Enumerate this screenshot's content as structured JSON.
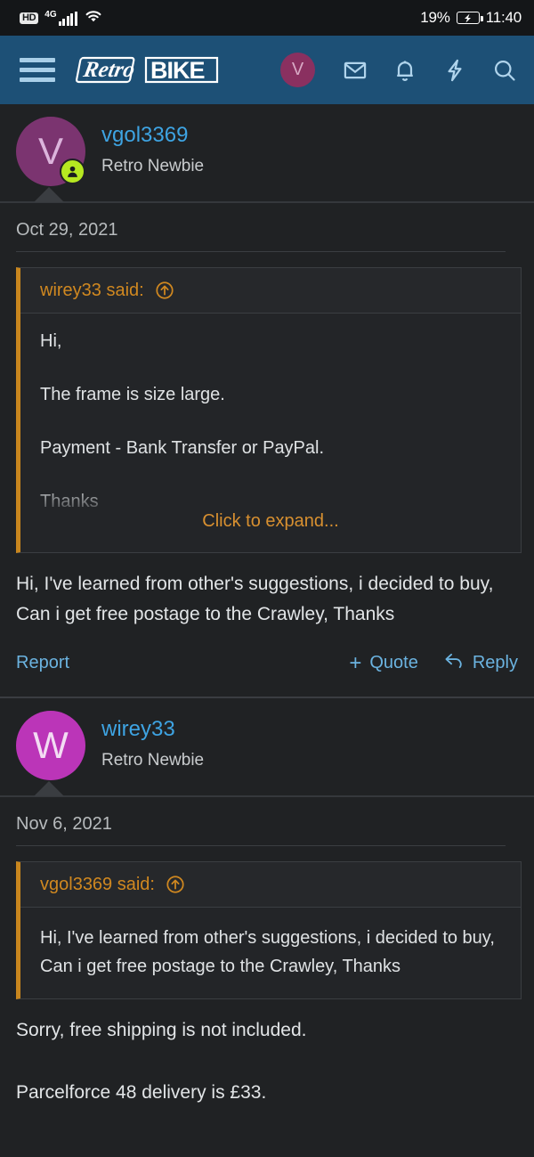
{
  "statusbar": {
    "hd_badge": "HD",
    "network_type": "4G",
    "battery_percent": "19%",
    "clock": "11:40"
  },
  "header": {
    "logo_retro": "Retro",
    "logo_bike": "BIKE",
    "avatar_initial": "V",
    "icons": [
      "menu-icon",
      "mail-icon",
      "bell-icon",
      "bolt-icon",
      "search-icon"
    ]
  },
  "posts": [
    {
      "author": "vgol3369",
      "title": "Retro Newbie",
      "avatar_initial": "V",
      "avatar_color": "#7b3470",
      "online": true,
      "date": "Oct 29, 2021",
      "quote": {
        "author_said": "wirey33 said:",
        "jump_icon": "arrow-up-circle-icon",
        "lines": [
          "Hi,",
          "The frame is size large.",
          "Payment - Bank Transfer or PayPal.",
          "Thanks"
        ],
        "expand_label": "Click to expand...",
        "collapsed": true
      },
      "body": [
        "Hi, I've learned from other's suggestions, i decided to buy, Can i get free postage to the Crawley, Thanks"
      ],
      "actions": {
        "report": "Report",
        "quote": "Quote",
        "reply": "Reply"
      }
    },
    {
      "author": "wirey33",
      "title": "Retro Newbie",
      "avatar_initial": "W",
      "avatar_color": "#bb35b8",
      "online": false,
      "date": "Nov 6, 2021",
      "quote": {
        "author_said": "vgol3369 said:",
        "jump_icon": "arrow-up-circle-icon",
        "lines": [
          "Hi, I've learned from other's suggestions, i decided to buy, Can i get free postage to the Crawley, Thanks"
        ],
        "collapsed": false
      },
      "body": [
        "Sorry, free shipping is not included.",
        "Parcelforce 48 delivery is £33."
      ]
    }
  ],
  "colors": {
    "header_bg": "#1d5076",
    "page_bg": "#202224",
    "link": "#3ea4e3",
    "quote_accent": "#c8861e",
    "action_link": "#6bb3e0",
    "online_badge": "#b6e821"
  }
}
